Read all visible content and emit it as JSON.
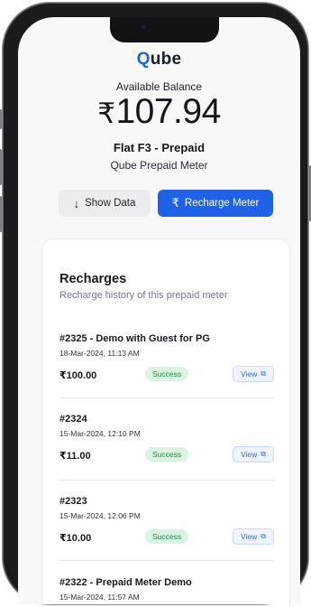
{
  "app": {
    "logo_q": "Q",
    "logo_rest": "ube"
  },
  "balance": {
    "label": "Available Balance",
    "currency": "₹",
    "amount": "107.94"
  },
  "meter": {
    "flat": "Flat F3 - Prepaid",
    "name": "Qube Prepaid Meter"
  },
  "actions": {
    "show_data_label": "Show Data",
    "recharge_label": "Recharge Meter"
  },
  "recharges": {
    "title": "Recharges",
    "subtitle": "Recharge history of this prepaid meter",
    "view_label": "View",
    "items": [
      {
        "title": "#2325 - Demo with Guest for PG",
        "date": "18-Mar-2024, 11:13 AM",
        "amount": "₹100.00",
        "status": "Success"
      },
      {
        "title": "#2324",
        "date": "15-Mar-2024, 12:10 PM",
        "amount": "₹11.00",
        "status": "Success"
      },
      {
        "title": "#2323",
        "date": "15-Mar-2024, 12:06 PM",
        "amount": "₹10.00",
        "status": "Success"
      },
      {
        "title": "#2322 - Prepaid Meter Demo",
        "date": "15-Mar-2024, 11:57 AM",
        "amount": "",
        "status": ""
      }
    ]
  },
  "colors": {
    "accent": "#1f62e8",
    "success_bg": "#d9f5e2",
    "success_text": "#1f8a4c"
  },
  "icons": {
    "show_data": "arrow-down-icon",
    "recharge": "rupee-icon",
    "view": "external-link-icon"
  }
}
